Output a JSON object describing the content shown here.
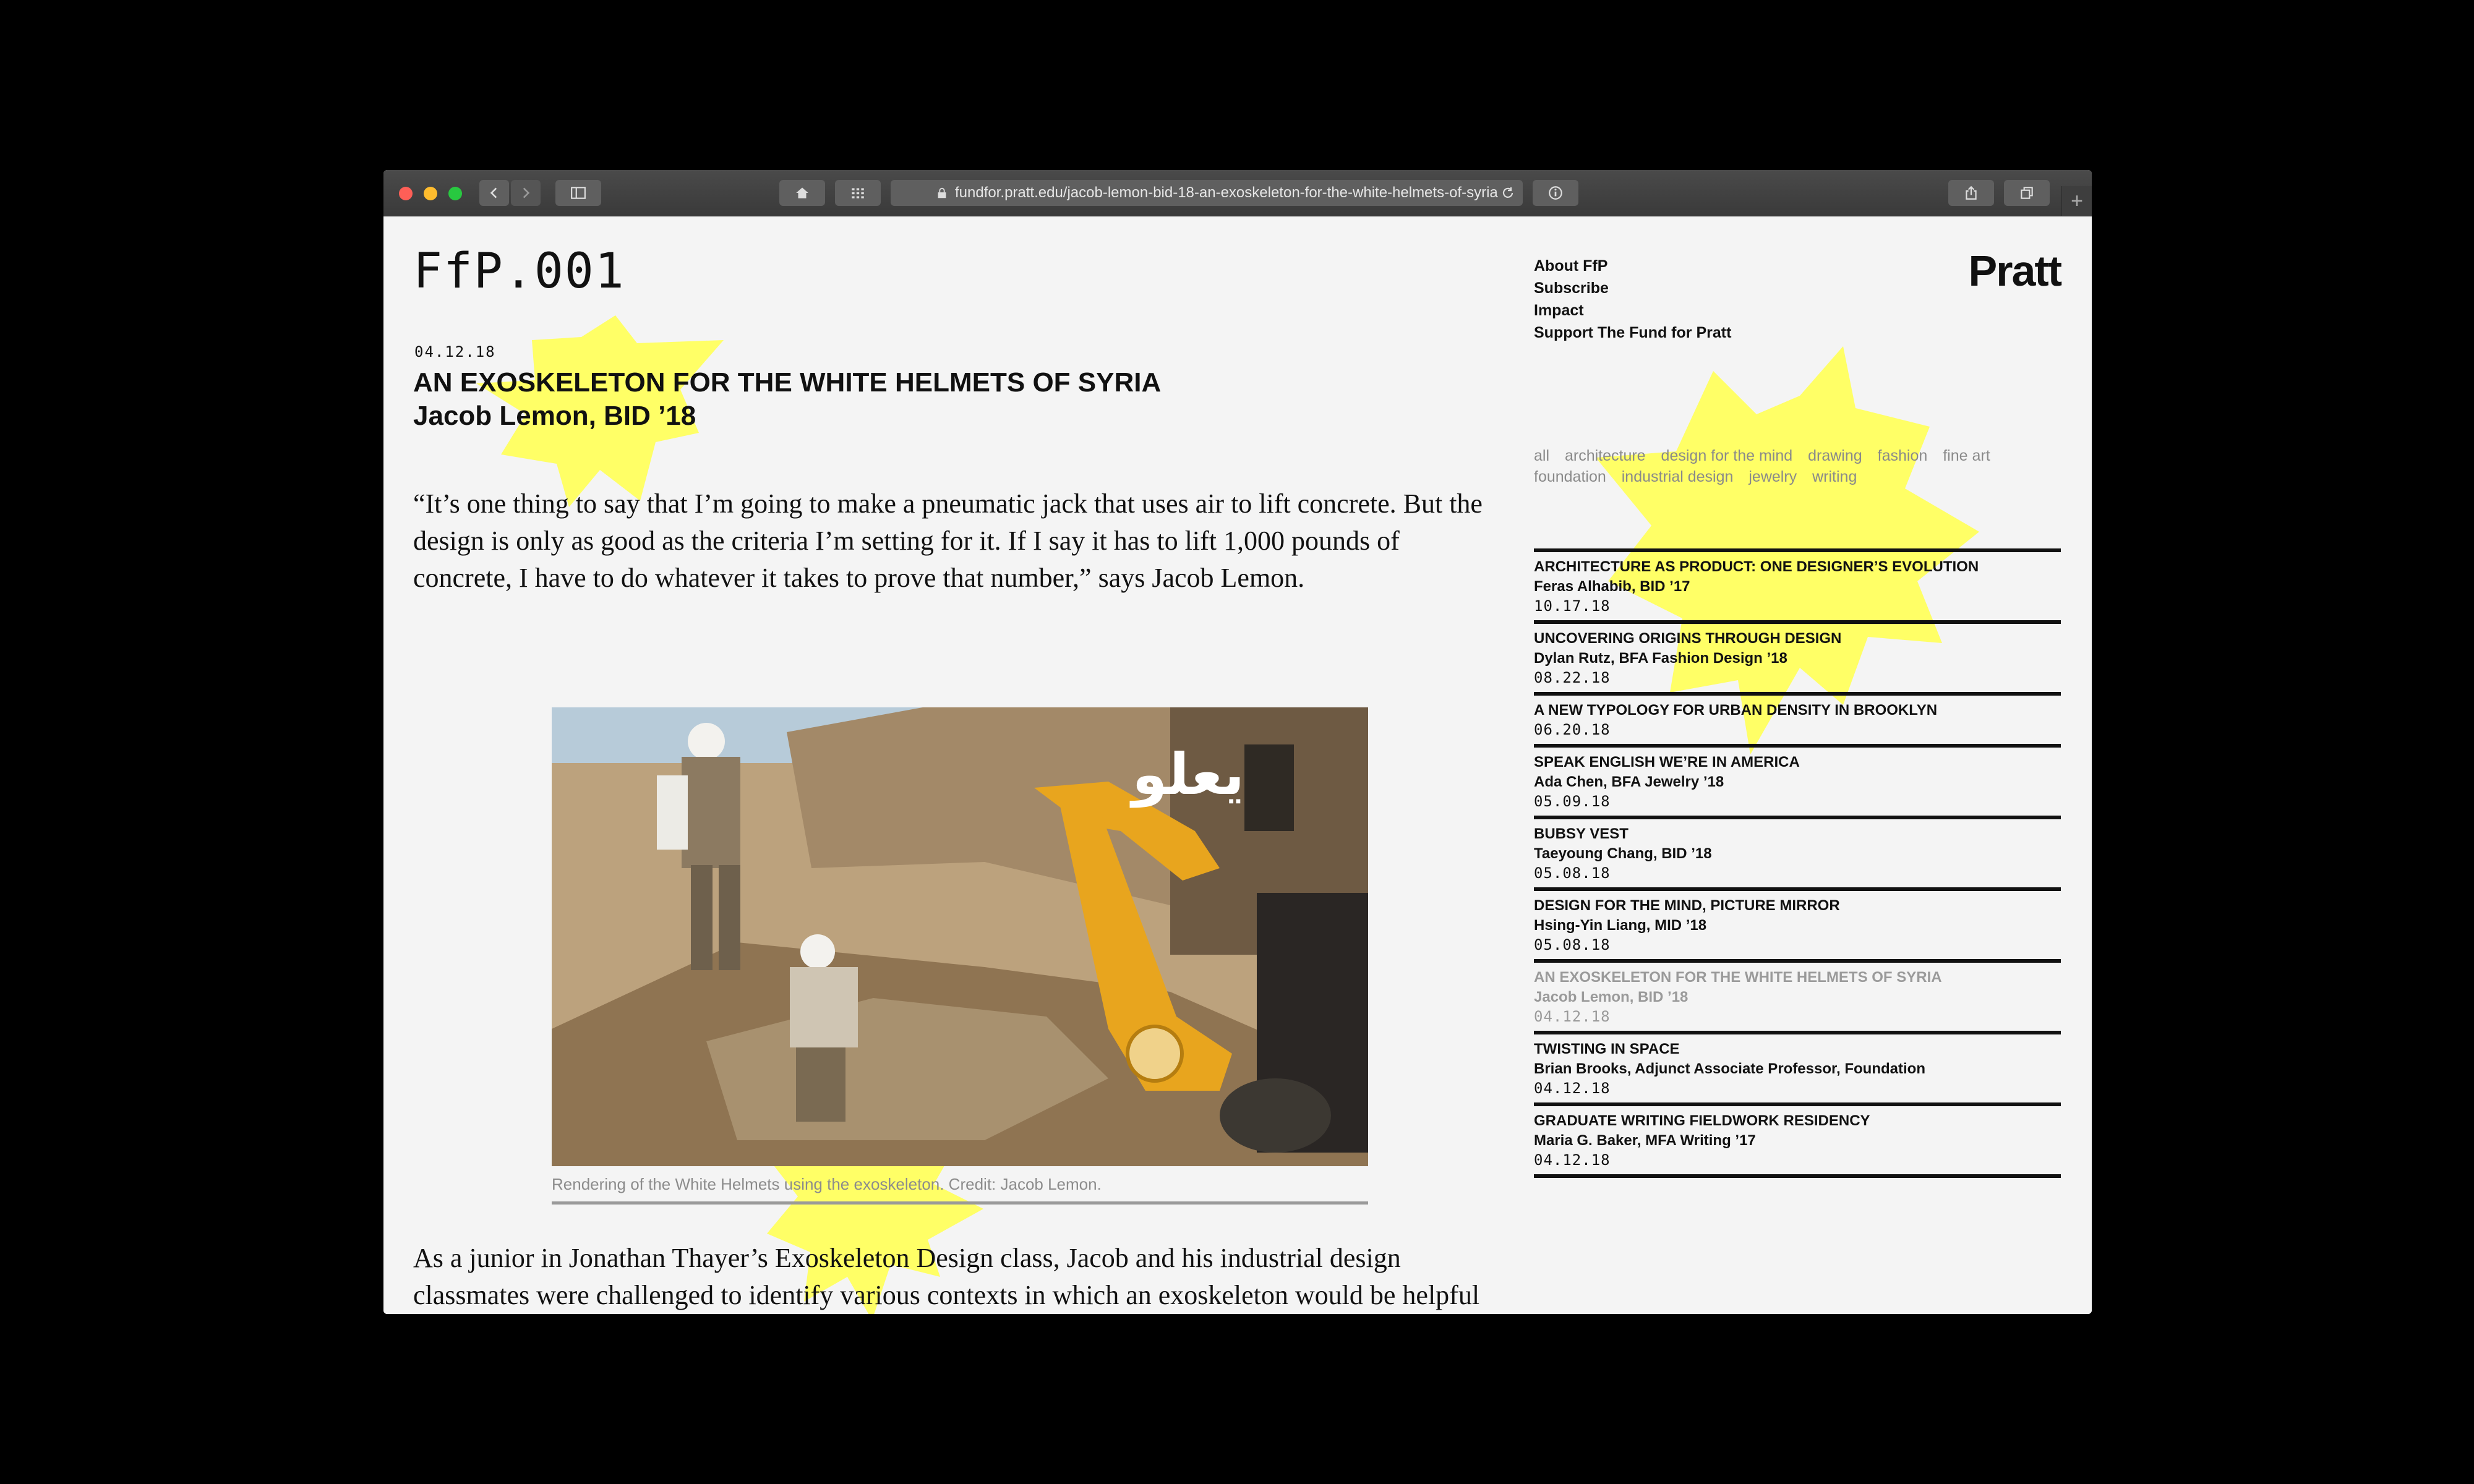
{
  "browser": {
    "url": "fundfor.pratt.edu/jacob-lemon-bid-18-an-exoskeleton-for-the-white-helmets-of-syria",
    "new_tab_label": "+"
  },
  "site": {
    "logo": "FfP.001",
    "brand": "Pratt",
    "nav": [
      "About FfP",
      "Subscribe",
      "Impact",
      "Support The Fund for Pratt"
    ],
    "filters": [
      "all",
      "architecture",
      "design for the mind",
      "drawing",
      "fashion",
      "fine art",
      "foundation",
      "industrial design",
      "jewelry",
      "writing"
    ]
  },
  "article": {
    "date": "04.12.18",
    "title": "AN EXOSKELETON FOR THE WHITE HELMETS OF SYRIA",
    "byline": "Jacob Lemon, BID ’18",
    "quote": "“It’s one thing to say that I’m going to make a pneumatic jack that uses air to lift concrete. But the design is only as good as the criteria I’m setting for it. If I say it has to lift 1,000 pounds of concrete, I have to do whatever it takes to prove that number,” says Jacob Lemon.",
    "image_overlay_text": "يعلو",
    "caption": "Rendering of the White Helmets using the exoskeleton. Credit: Jacob Lemon.",
    "paragraph": "As a junior in Jonathan Thayer’s Exoskeleton Design class, Jacob and his industrial design classmates were challenged to identify various contexts in which an exoskeleton would be helpful and then choose one to design a viable solution for. One of the ideas Jacob, who had"
  },
  "stories": [
    {
      "title": "ARCHITECTURE AS PRODUCT: ONE DESIGNER’S EVOLUTION",
      "author": "Feras Alhabib, BID ’17",
      "date": "10.17.18"
    },
    {
      "title": "UNCOVERING ORIGINS THROUGH DESIGN",
      "author": "Dylan Rutz, BFA Fashion Design ’18",
      "date": "08.22.18"
    },
    {
      "title": "A NEW TYPOLOGY FOR URBAN DENSITY IN BROOKLYN",
      "author": "",
      "date": "06.20.18"
    },
    {
      "title": "SPEAK ENGLISH WE’RE IN AMERICA",
      "author": "Ada Chen, BFA Jewelry ’18",
      "date": "05.09.18"
    },
    {
      "title": "BUBSY VEST",
      "author": "Taeyoung Chang, BID ’18",
      "date": "05.08.18"
    },
    {
      "title": "DESIGN FOR THE MIND, PICTURE MIRROR",
      "author": "Hsing-Yin Liang, MID ’18",
      "date": "05.08.18"
    },
    {
      "title": "AN EXOSKELETON FOR THE WHITE HELMETS OF SYRIA",
      "author": "Jacob Lemon, BID ’18",
      "date": "04.12.18",
      "current": true
    },
    {
      "title": "TWISTING IN SPACE",
      "author": "Brian Brooks, Adjunct Associate Professor, Foundation",
      "date": "04.12.18"
    },
    {
      "title": "GRADUATE WRITING FIELDWORK RESIDENCY",
      "author": "Maria G. Baker, MFA Writing ’17",
      "date": "04.12.18"
    }
  ],
  "colors": {
    "highlight": "#ffff66",
    "text": "#111111",
    "muted": "#9a9a9a"
  }
}
